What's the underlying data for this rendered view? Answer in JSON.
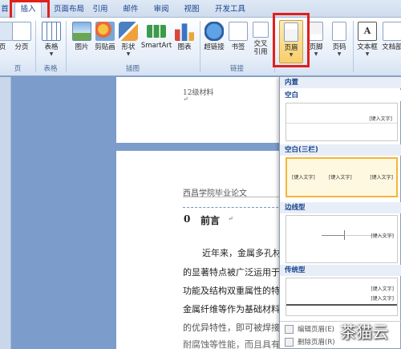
{
  "tabs": [
    {
      "label": "首页"
    },
    {
      "label": "插入"
    },
    {
      "label": "页面布局"
    },
    {
      "label": "引用"
    },
    {
      "label": "邮件"
    },
    {
      "label": "审阅"
    },
    {
      "label": "视图"
    },
    {
      "label": "开发工具"
    }
  ],
  "ribbon": {
    "buttons": {
      "page_label": "页",
      "pagebreak_label": "分页",
      "table_label": "表格",
      "picture_label": "图片",
      "clipart_label": "剪贴画",
      "shapes_label": "形状",
      "smartart_label": "SmartArt",
      "chart_label": "图表",
      "hyperlink_label": "超链接",
      "bookmark_label": "书签",
      "crossref_label1": "交叉",
      "crossref_label2": "引用",
      "header_label": "页眉",
      "footer_label": "页脚",
      "pagenum_label": "页码",
      "textbox_label": "文本框",
      "docparts_label": "文档部"
    },
    "groups": {
      "pages": "页",
      "tables": "表格",
      "illustrations": "插图",
      "links": "链接"
    }
  },
  "document": {
    "page1_header": "12级材料",
    "page2_header": "西昌学院毕业论文",
    "heading_num": "0",
    "heading": "前言",
    "lines": [
      "近年来，金属多孔材",
      "的显著特点被广泛运用于",
      "功能及结构双重属性的特",
      "金属纤维等作为基础材料",
      "的优异特性，即可被焊接",
      "耐腐蚀等性能，而且具有"
    ]
  },
  "gallery": {
    "section_builtin": "内置",
    "item1": "空白",
    "item2": "空白(三栏)",
    "item3": "边线型",
    "item4": "传统型",
    "placeholder": "[键入文字]",
    "menu_edit": "编辑页眉(E)",
    "menu_remove": "删除页眉(R)"
  },
  "watermark": "茶猫云",
  "colors": {
    "accent_red": "#e0201b",
    "ribbon_text": "#15428b",
    "doc_bg": "#7c9ccb"
  }
}
